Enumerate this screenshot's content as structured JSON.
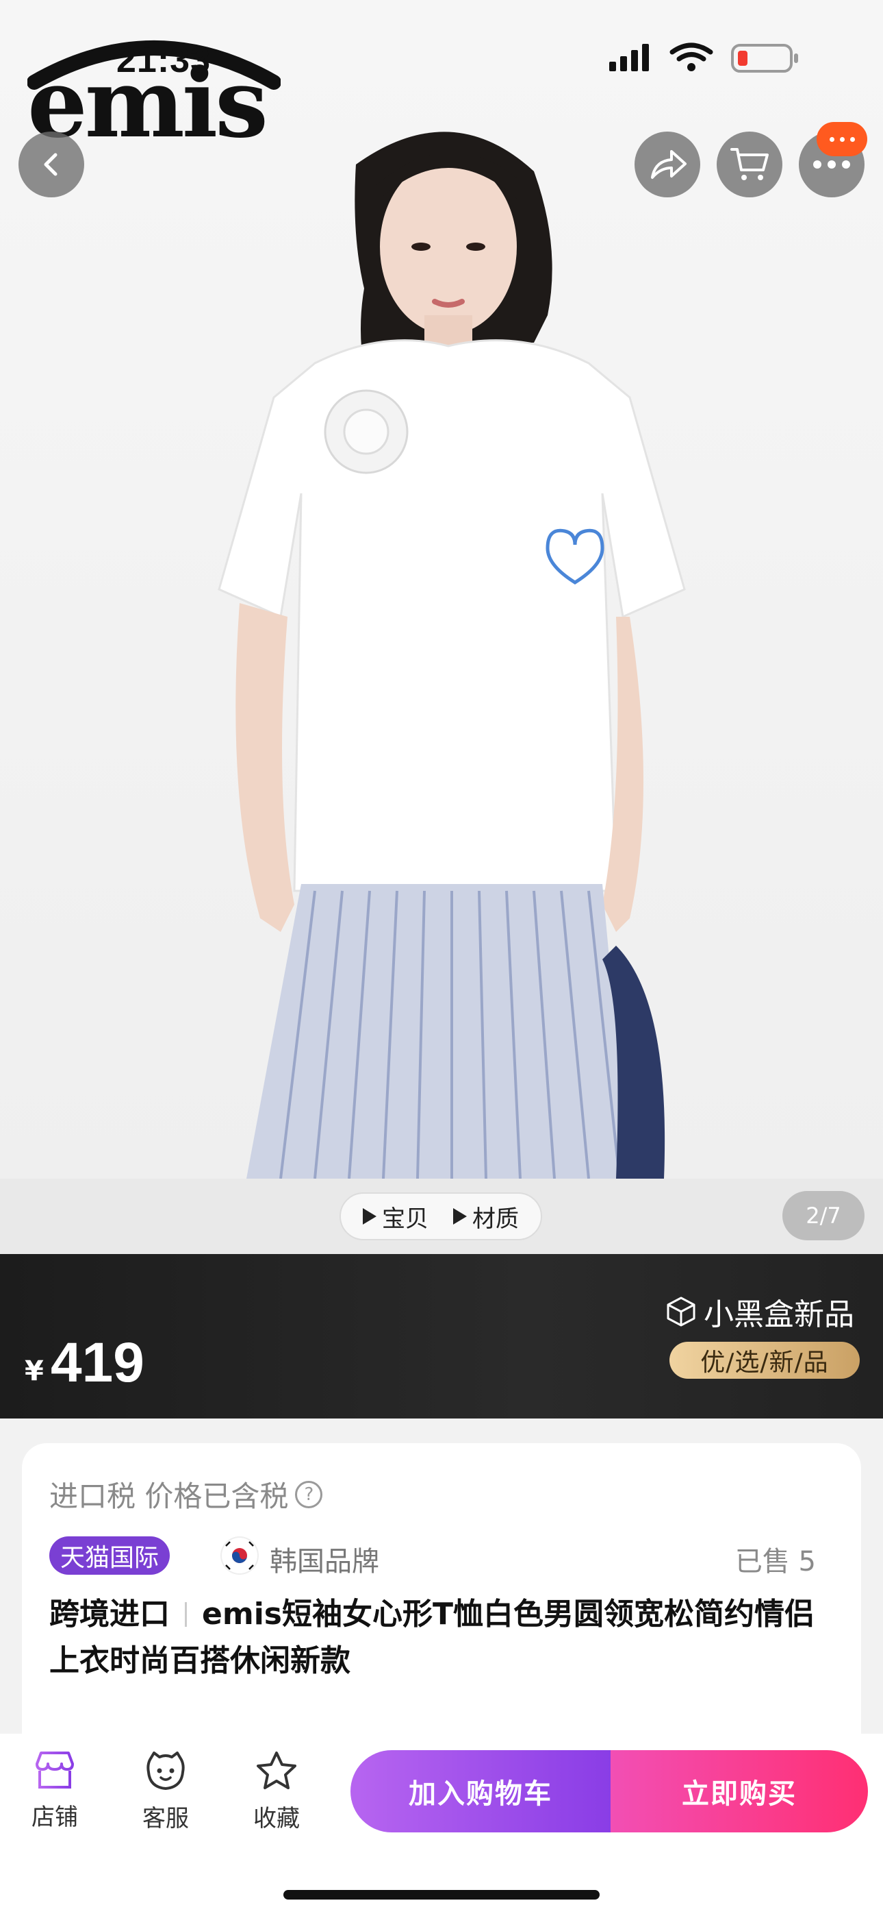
{
  "status_bar": {
    "time": "21:33"
  },
  "brand": {
    "logo_text": "emis"
  },
  "hero": {
    "video_tabs": [
      "宝贝",
      "材质"
    ],
    "page_counter": "2/7"
  },
  "price": {
    "currency": "¥",
    "value": "419",
    "blackbox_label": "小黑盒新品",
    "youxuan_label": "优/选/新/品"
  },
  "info": {
    "tax_note": "进口税 价格已含税",
    "tmall_badge": "天猫国际",
    "origin": "韩国品牌",
    "sold": "已售 5",
    "title_prefix": "跨境进口",
    "title": "emis短袖女心形T恤白色男圆领宽松简约情侣上衣时尚百搭休闲新款"
  },
  "bottom_bar": {
    "store_label": "店铺",
    "service_label": "客服",
    "favorite_label": "收藏",
    "add_to_cart": "加入购物车",
    "buy_now": "立即购买"
  },
  "colors": {
    "accent_purple": "#8a3de6",
    "accent_pink": "#ff2f73",
    "more_badge": "#ff5a1f"
  }
}
